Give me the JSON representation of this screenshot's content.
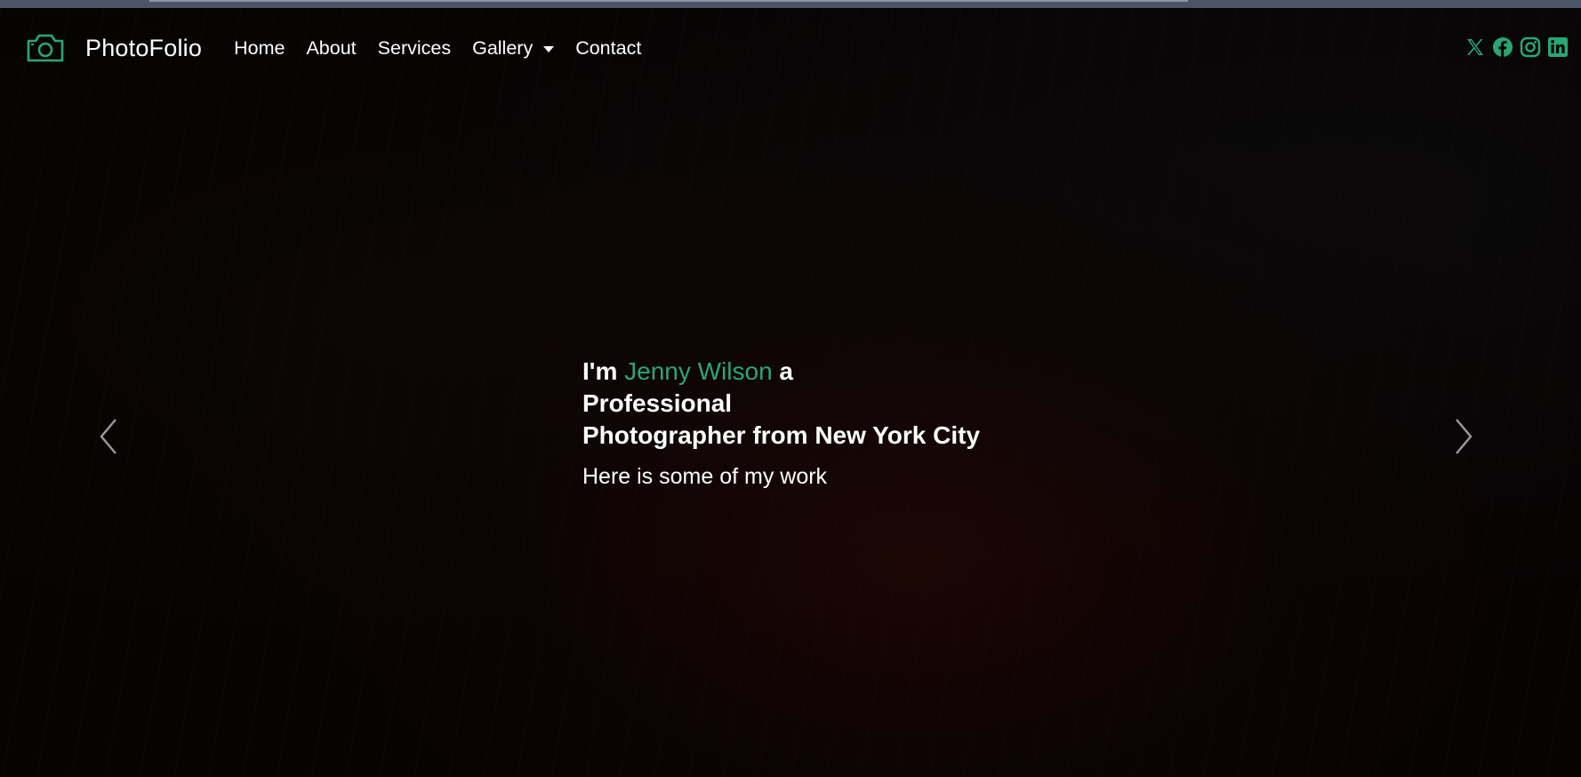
{
  "brand": {
    "name": "PhotoFolio",
    "icon": "camera-icon"
  },
  "nav": {
    "items": [
      {
        "label": "Home"
      },
      {
        "label": "About"
      },
      {
        "label": "Services"
      },
      {
        "label": "Gallery",
        "dropdown": true
      },
      {
        "label": "Contact"
      }
    ]
  },
  "social": [
    {
      "icon": "x-twitter-icon"
    },
    {
      "icon": "facebook-icon"
    },
    {
      "icon": "instagram-icon"
    },
    {
      "icon": "linkedin-icon"
    }
  ],
  "hero": {
    "intro": "I'm ",
    "name": "Jenny Wilson",
    "after_name": " a",
    "line2": "Professional",
    "line3": "Photographer from New York City",
    "subtitle": "Here is some of my work"
  },
  "carousel": {
    "prev_icon": "chevron-left-icon",
    "next_icon": "chevron-right-icon"
  },
  "colors": {
    "accent": "#27a776",
    "background": "#000000",
    "text": "#ffffff"
  }
}
